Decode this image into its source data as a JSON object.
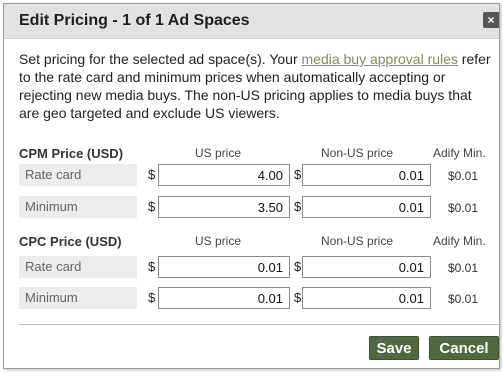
{
  "dialog": {
    "title": "Edit Pricing - 1 of 1 Ad Spaces",
    "close_glyph": "×"
  },
  "description": {
    "part1": "Set pricing for the selected ad space(s). Your ",
    "link_text": "media buy approval rules",
    "part2": " refer to the rate card and minimum prices when automatically accepting or rejecting new media buys. The non-US pricing applies to media buys that are geo targeted and exclude US viewers."
  },
  "cpm": {
    "section_label": "CPM Price (USD)",
    "us_header": "US price",
    "nonus_header": "Non-US price",
    "min_header": "Adify Min.",
    "rows": [
      {
        "label": "Rate card",
        "currency_us": "$",
        "us_value": "4.00",
        "currency_nonus": "$",
        "nonus_value": "0.01",
        "adify_min": "$0.01"
      },
      {
        "label": "Minimum",
        "currency_us": "$",
        "us_value": "3.50",
        "currency_nonus": "$",
        "nonus_value": "0.01",
        "adify_min": "$0.01"
      }
    ]
  },
  "cpc": {
    "section_label": "CPC Price (USD)",
    "us_header": "US price",
    "nonus_header": "Non-US price",
    "min_header": "Adify Min.",
    "rows": [
      {
        "label": "Rate card",
        "currency_us": "$",
        "us_value": "0.01",
        "currency_nonus": "$",
        "nonus_value": "0.01",
        "adify_min": "$0.01"
      },
      {
        "label": "Minimum",
        "currency_us": "$",
        "us_value": "0.01",
        "currency_nonus": "$",
        "nonus_value": "0.01",
        "adify_min": "$0.01"
      }
    ]
  },
  "buttons": {
    "save_label": "Save",
    "cancel_label": "Cancel"
  },
  "colors": {
    "button_bg": "#4e6a3e",
    "link": "#7f8f55",
    "titlebar_bg": "#e2e2e2"
  }
}
